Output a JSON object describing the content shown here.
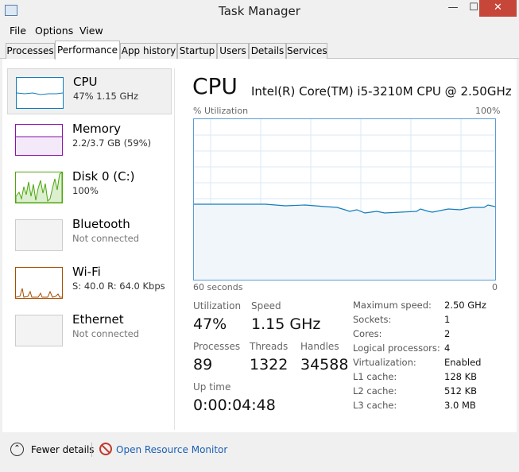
{
  "window": {
    "title": "Task Manager",
    "min_glyph": "—",
    "max_glyph": "☐",
    "close_glyph": "✕"
  },
  "menu": [
    "File",
    "Options",
    "View"
  ],
  "tabs": [
    "Processes",
    "Performance",
    "App history",
    "Startup",
    "Users",
    "Details",
    "Services"
  ],
  "active_tab": "Performance",
  "sidebar": [
    {
      "title": "CPU",
      "sub": "47% 1.15 GHz",
      "color": "#117dbb"
    },
    {
      "title": "Memory",
      "sub": "2.2/3.7 GB (59%)",
      "color": "#8b12ae"
    },
    {
      "title": "Disk 0 (C:)",
      "sub": "100%",
      "color": "#4da60c"
    },
    {
      "title": "Bluetooth",
      "sub": "Not connected",
      "color": "#cccccc"
    },
    {
      "title": "Wi-Fi",
      "sub": "S: 40.0  R: 64.0 Kbps",
      "color": "#a74f01"
    },
    {
      "title": "Ethernet",
      "sub": "Not connected",
      "color": "#cccccc"
    }
  ],
  "main": {
    "title": "CPU",
    "model": "Intel(R) Core(TM) i5-3210M CPU @ 2.50GHz",
    "graph": {
      "y_label": "% Utilization",
      "y_max_label": "100%",
      "x_left_label": "60 seconds",
      "x_right_label": "0",
      "line_color": "#117dbb",
      "fill_color": "#f1f6fb"
    },
    "stats": {
      "utilization_label": "Utilization",
      "utilization": "47%",
      "speed_label": "Speed",
      "speed": "1.15 GHz",
      "processes_label": "Processes",
      "processes": "89",
      "threads_label": "Threads",
      "threads": "1322",
      "handles_label": "Handles",
      "handles": "34588",
      "uptime_label": "Up time",
      "uptime": "0:00:04:48"
    },
    "specs": [
      {
        "label": "Maximum speed:",
        "value": "2.50 GHz"
      },
      {
        "label": "Sockets:",
        "value": "1"
      },
      {
        "label": "Cores:",
        "value": "2"
      },
      {
        "label": "Logical processors:",
        "value": "4"
      },
      {
        "label": "Virtualization:",
        "value": "Enabled"
      },
      {
        "label": "L1 cache:",
        "value": "128 KB"
      },
      {
        "label": "L2 cache:",
        "value": "512 KB"
      },
      {
        "label": "L3 cache:",
        "value": "3.0 MB"
      }
    ]
  },
  "footer": {
    "fewer_details": "Fewer details",
    "open_resource_monitor": "Open Resource Monitor"
  }
}
